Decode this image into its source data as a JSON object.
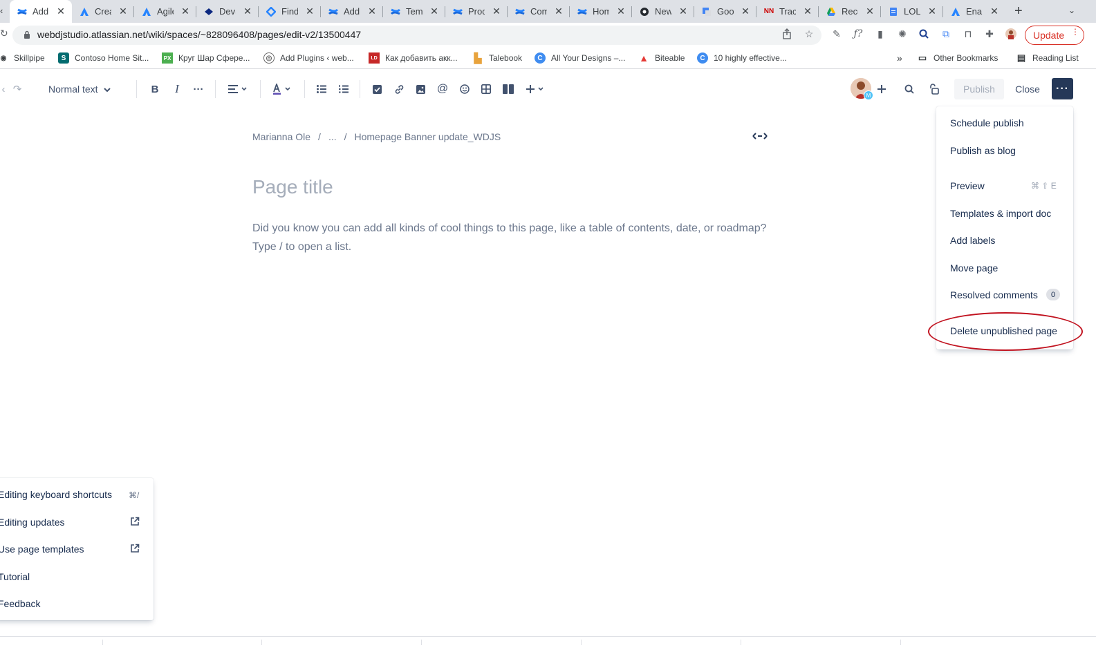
{
  "browser": {
    "tabs": [
      {
        "label": "Add I",
        "icon": "confluence-icon",
        "active": true
      },
      {
        "label": "Crea",
        "icon": "atlassian-icon"
      },
      {
        "label": "Agile",
        "icon": "atlassian-icon"
      },
      {
        "label": "DevS",
        "icon": "diamond-icon"
      },
      {
        "label": "Find",
        "icon": "jira-icon"
      },
      {
        "label": "Add",
        "icon": "confluence-icon"
      },
      {
        "label": "Temp",
        "icon": "confluence-icon"
      },
      {
        "label": "Prod",
        "icon": "confluence-icon"
      },
      {
        "label": "Com",
        "icon": "confluence-icon"
      },
      {
        "label": "Hom",
        "icon": "confluence-icon"
      },
      {
        "label": "New",
        "icon": "github-icon"
      },
      {
        "label": "Goog",
        "icon": "google-translate-icon"
      },
      {
        "label": "Track",
        "icon": "nn-icon"
      },
      {
        "label": "Rece",
        "icon": "google-drive-icon"
      },
      {
        "label": "LOL",
        "icon": "google-docs-icon"
      },
      {
        "label": "Enab",
        "icon": "atlassian-icon"
      }
    ],
    "url": "webdjstudio.atlassian.net/wiki/spaces/~828096408/pages/edit-v2/13500447",
    "update_label": "Update",
    "bookmarks": [
      {
        "label": "Skillpipe"
      },
      {
        "label": "Contoso Home Sit..."
      },
      {
        "label": "Круг Шар Сфере..."
      },
      {
        "label": "Add Plugins ‹ web..."
      },
      {
        "label": "Как добавить акк..."
      },
      {
        "label": "Talebook"
      },
      {
        "label": "All Your Designs –..."
      },
      {
        "label": "Biteable"
      },
      {
        "label": "10 highly effective..."
      }
    ],
    "overflow": "»",
    "other_bookmarks": "Other Bookmarks",
    "reading_list": "Reading List"
  },
  "toolbar": {
    "text_style": "Normal text",
    "publish_label": "Publish",
    "close_label": "Close",
    "avatar_badge": "M"
  },
  "page": {
    "breadcrumb": [
      "Marianna Ole",
      "...",
      "Homepage Banner update_WDJS"
    ],
    "breadcrumb_sep": "/",
    "title_placeholder": "Page title",
    "hint_line1": "Did you know you can add all kinds of cool things to this page, like a table of contents, date, or roadmap?",
    "hint_line2": "Type / to open a list."
  },
  "more_menu": {
    "items": [
      "Schedule publish",
      "Publish as blog",
      "Preview",
      "Templates & import doc",
      "Add labels",
      "Move page",
      "Resolved comments",
      "Delete unpublished page"
    ],
    "preview_shortcut": "⌘ ⇧ E",
    "resolved_count": "0",
    "highlight_color": "#C1121F"
  },
  "help_menu": {
    "items": [
      "Editing keyboard shortcuts",
      "Editing updates",
      "Use page templates",
      "Tutorial",
      "Feedback"
    ],
    "shortcut_hint": "⌘/"
  },
  "colors": {
    "chrome_tabbar": "#DEE1E6",
    "primary_dark": "#253858",
    "text": "#172B4D",
    "subtle_text": "#6B778C",
    "update_red": "#d93025"
  }
}
